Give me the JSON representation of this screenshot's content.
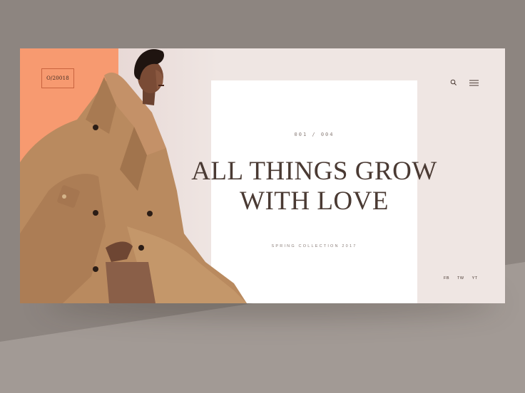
{
  "brand": {
    "logo_text": "O/20018"
  },
  "colors": {
    "background": "#8d8580",
    "accent_orange": "#f79a70",
    "card_pink": "#efe6e3",
    "text_dark": "#4a3a33"
  },
  "header": {
    "search_icon": "search-icon",
    "menu_icon": "hamburger-menu-icon"
  },
  "slider": {
    "counter": "001  /  004",
    "headline_line1": "ALL THINGS GROW",
    "headline_line2": "WITH LOVE",
    "subtitle": "SPRING COLLECTION 2017"
  },
  "social": {
    "fb": "FB",
    "tw": "TW",
    "yt": "YT"
  }
}
